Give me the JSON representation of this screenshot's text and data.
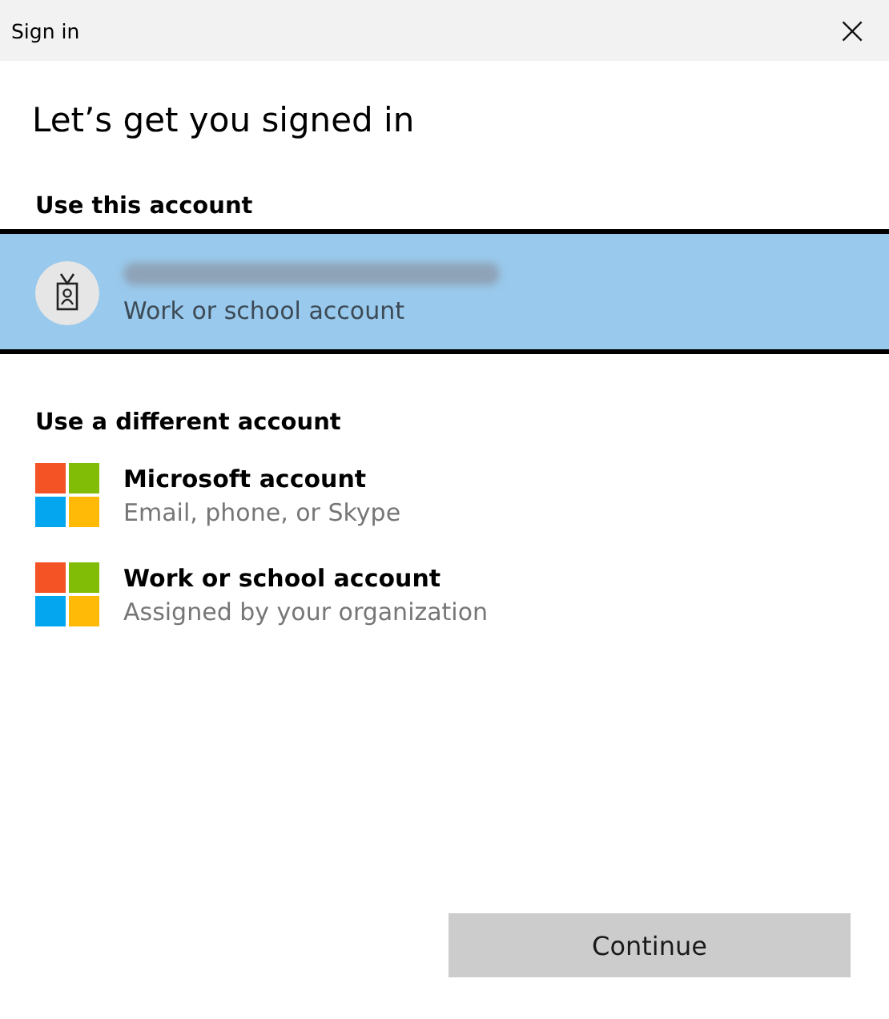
{
  "window": {
    "title": "Sign in",
    "close": "×"
  },
  "heading": "Let’s get you signed in",
  "sections": [
    {
      "heading": "Use this account",
      "accounts": [
        {
          "kind": "badge",
          "email": {
            "kind": "redacted"
          },
          "subtitle": "Work or school account",
          "selected": true
        }
      ]
    },
    {
      "heading": "Use a different account",
      "accounts": [
        {
          "kind": "tiles",
          "title": "Microsoft account",
          "subtitle": "Email, phone, or Skype",
          "selected": false
        },
        {
          "kind": "tiles",
          "title": "Work or school account",
          "subtitle": "Assigned by your organization",
          "selected": false
        }
      ]
    }
  ],
  "buttons": [
    {
      "label": "Continue",
      "disabled": true
    }
  ]
}
